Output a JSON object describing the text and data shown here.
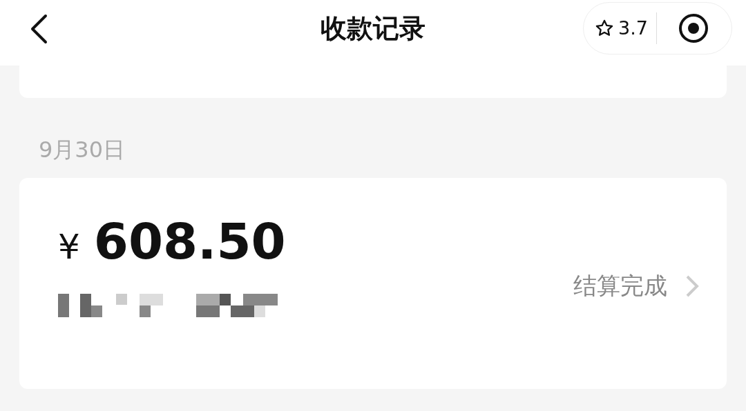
{
  "header": {
    "title": "收款记录",
    "rating": "3.7"
  },
  "sections": [
    {
      "date": "9月30日",
      "records": [
        {
          "currency": "¥",
          "amount": "608.50",
          "status": "结算完成"
        }
      ]
    }
  ]
}
